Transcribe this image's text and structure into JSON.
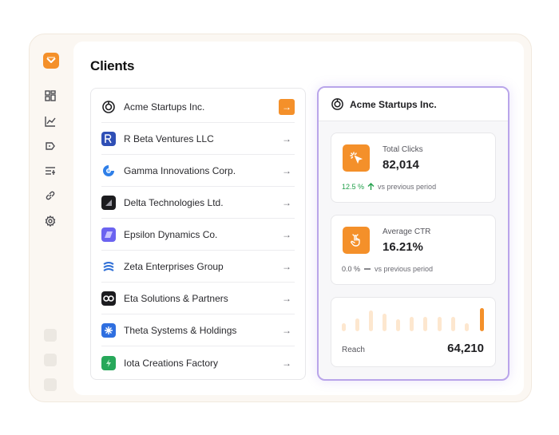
{
  "page": {
    "title": "Clients"
  },
  "sidebar": {
    "items": [
      {
        "icon": "dashboard-icon"
      },
      {
        "icon": "analytics-icon"
      },
      {
        "icon": "tag-icon"
      },
      {
        "icon": "filter-list-icon"
      },
      {
        "icon": "link-icon"
      },
      {
        "icon": "settings-icon"
      }
    ]
  },
  "clients": [
    {
      "name": "Acme Startups Inc.",
      "logo": "acme-logo-icon",
      "active": true
    },
    {
      "name": "R Beta Ventures LLC",
      "logo": "beta-logo-icon",
      "active": false
    },
    {
      "name": "Gamma Innovations Corp.",
      "logo": "gamma-logo-icon",
      "active": false
    },
    {
      "name": "Delta Technologies Ltd.",
      "logo": "delta-logo-icon",
      "active": false
    },
    {
      "name": "Epsilon Dynamics Co.",
      "logo": "epsilon-logo-icon",
      "active": false
    },
    {
      "name": "Zeta Enterprises Group",
      "logo": "zeta-logo-icon",
      "active": false
    },
    {
      "name": "Eta Solutions & Partners",
      "logo": "eta-logo-icon",
      "active": false
    },
    {
      "name": "Theta Systems & Holdings",
      "logo": "theta-logo-icon",
      "active": false
    },
    {
      "name": "Iota Creations Factory",
      "logo": "iota-logo-icon",
      "active": false
    }
  ],
  "detail": {
    "title": "Acme Startups Inc.",
    "clicks": {
      "label": "Total Clicks",
      "value": "82,014",
      "change": "12.5 %",
      "period": "vs previous period"
    },
    "ctr": {
      "label": "Average CTR",
      "value": "16.21%",
      "change": "0.0 %",
      "period": "vs previous period"
    },
    "reach": {
      "label": "Reach",
      "value": "64,210"
    }
  },
  "colors": {
    "accent": "#f4902a",
    "positive": "#22a04b",
    "highlight_border": "#b9a5ea",
    "bar_muted": "#fde7cf"
  }
}
